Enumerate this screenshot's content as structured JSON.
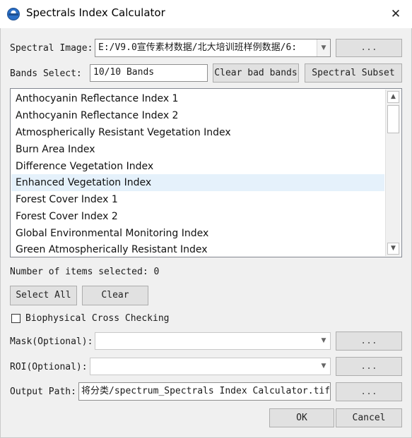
{
  "window": {
    "title": "Spectrals Index Calculator",
    "close_glyph": "✕"
  },
  "spectral_image": {
    "label": "Spectral Image:",
    "value": "E:/V9.0宣传素材数据/北大培训班样例数据/6:",
    "browse_label": "..."
  },
  "bands": {
    "label": "Bands Select:",
    "value": "10/10 Bands",
    "clear_bad_label": "Clear bad bands",
    "subset_label": "Spectral Subset"
  },
  "index_list": {
    "items": [
      "Anthocyanin Reflectance Index 1",
      "Anthocyanin Reflectance Index 2",
      "Atmospherically Resistant Vegetation Index",
      "Burn Area Index",
      "Difference Vegetation Index",
      "Enhanced Vegetation Index",
      "Forest Cover Index 1",
      "Forest Cover Index 2",
      "Global Environmental Monitoring Index",
      "Green Atmospherically Resistant Index"
    ],
    "highlighted_item": "Enhanced Vegetation Index"
  },
  "selection": {
    "count_text": "Number of items selected: 0",
    "select_all_label": "Select All",
    "clear_label": "Clear"
  },
  "biophysical": {
    "label": "Biophysical Cross Checking",
    "checked": false
  },
  "mask": {
    "label": "Mask(Optional):",
    "value": "",
    "browse_label": "..."
  },
  "roi": {
    "label": "ROI(Optional):",
    "value": "",
    "browse_label": "..."
  },
  "output": {
    "label": "Output Path:",
    "value": "将分类/spectrum_Spectrals Index Calculator.tif",
    "browse_label": "..."
  },
  "footer": {
    "ok_label": "OK",
    "cancel_label": "Cancel"
  },
  "icons": {
    "app": "app-globe-icon",
    "close": "close-icon",
    "combo": "chevron-down-icon",
    "scroll_up": "scroll-up-icon",
    "scroll_down": "scroll-down-icon"
  },
  "colors": {
    "highlight": "#e5f1fb",
    "titlebar": "#ffffff",
    "dialog": "#f0f0f0"
  }
}
